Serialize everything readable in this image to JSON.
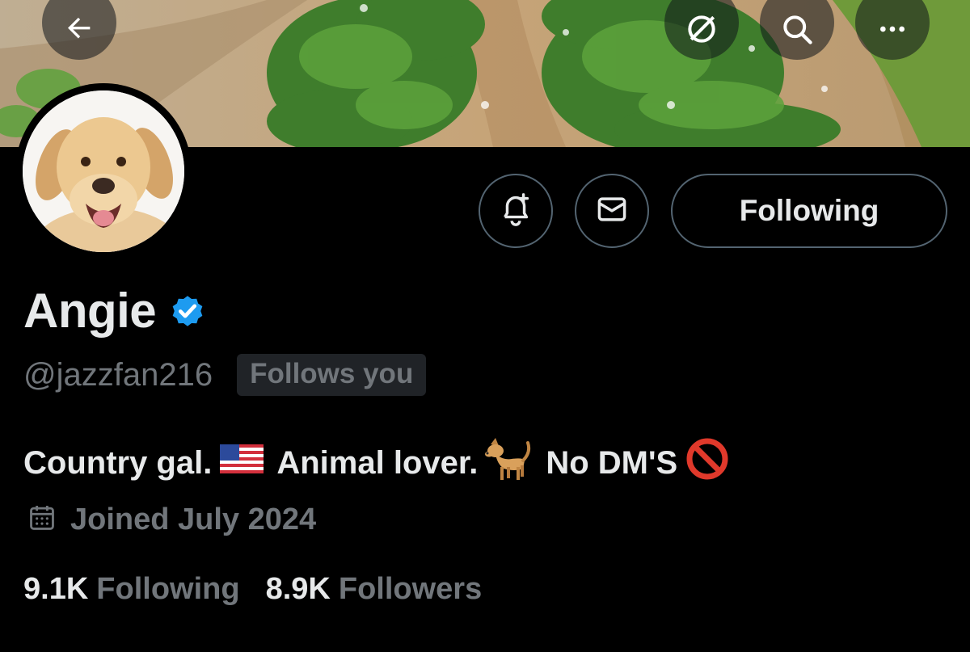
{
  "header": {
    "back_icon": "arrow-left-icon",
    "grok_icon": "grok-icon",
    "search_icon": "search-icon",
    "more_icon": "more-horizontal-icon"
  },
  "profile": {
    "name": "Angie",
    "verified": true,
    "handle": "@jazzfan216",
    "follows_you": "Follows you",
    "bio": {
      "part1": "Country gal.",
      "part2": "Animal lover.",
      "part3": "No DM'S"
    },
    "joined": "Joined July 2024",
    "following_count": "9.1K",
    "following_label": "Following",
    "followers_count": "8.9K",
    "followers_label": "Followers"
  },
  "actions": {
    "notify_icon": "bell-plus-icon",
    "message_icon": "envelope-icon",
    "follow_button_label": "Following"
  },
  "colors": {
    "background": "#000000",
    "primary_text": "#e7e9ea",
    "secondary_text": "#71767b",
    "verified_blue": "#1d9bf0",
    "border": "#536471"
  }
}
